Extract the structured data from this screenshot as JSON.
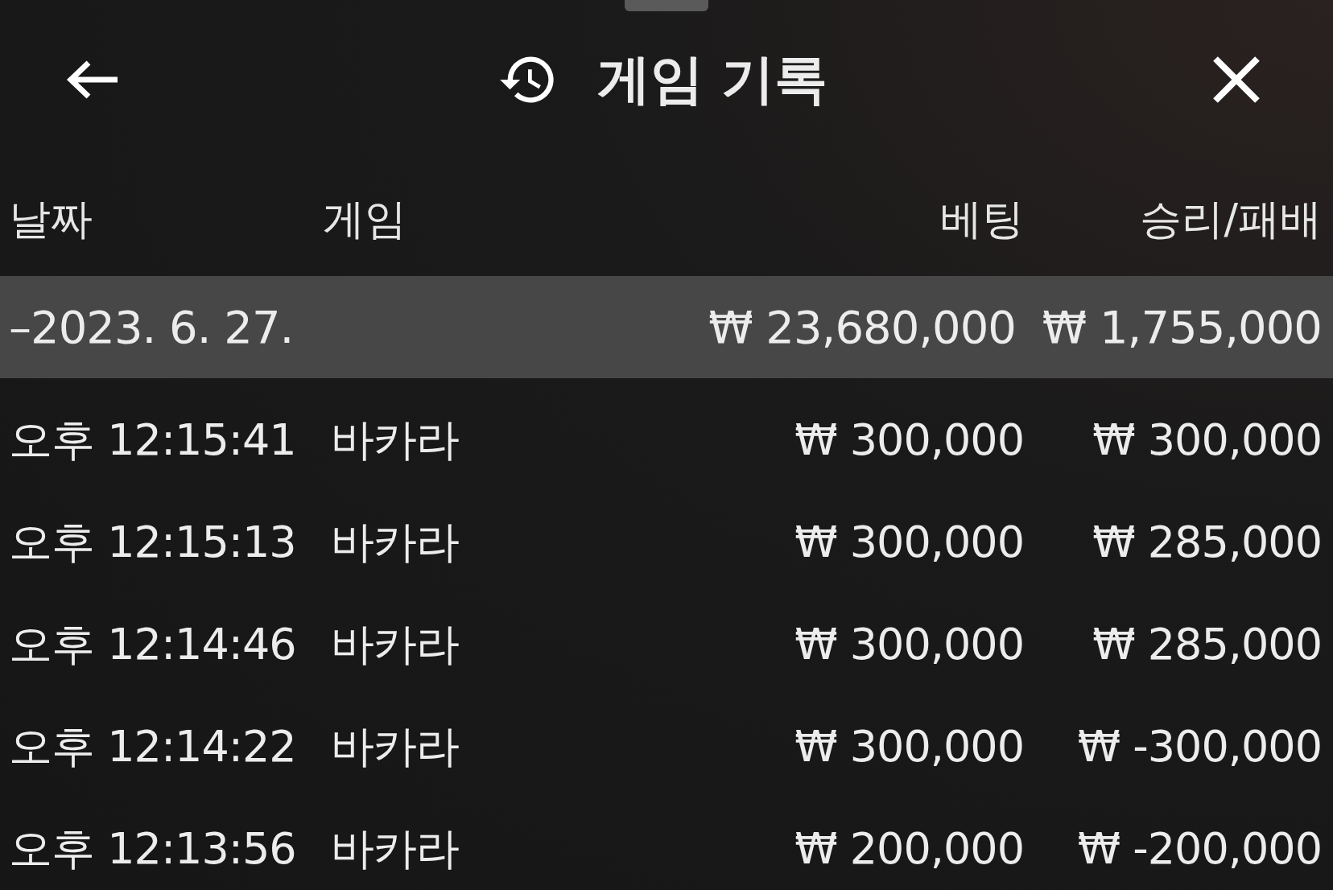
{
  "header": {
    "title": "게임 기록"
  },
  "columns": [
    "날짜",
    "게임",
    "베팅",
    "승리/패배"
  ],
  "group": {
    "date": "–2023. 6. 27.",
    "bet": "₩ 23,680,000",
    "result": "₩ 1,755,000"
  },
  "rows": [
    {
      "time": "오후 12:15:41",
      "game": "바카라",
      "bet": "₩ 300,000",
      "result": "₩ 300,000"
    },
    {
      "time": "오후 12:15:13",
      "game": "바카라",
      "bet": "₩ 300,000",
      "result": "₩ 285,000"
    },
    {
      "time": "오후 12:14:46",
      "game": "바카라",
      "bet": "₩ 300,000",
      "result": "₩ 285,000"
    },
    {
      "time": "오후 12:14:22",
      "game": "바카라",
      "bet": "₩ 300,000",
      "result": "₩ -300,000"
    },
    {
      "time": "오후 12:13:56",
      "game": "바카라",
      "bet": "₩ 200,000",
      "result": "₩ -200,000"
    }
  ]
}
